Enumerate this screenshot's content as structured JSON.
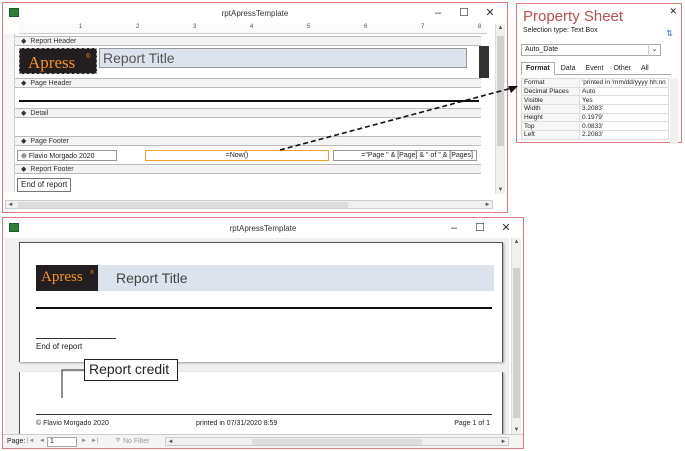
{
  "design_window": {
    "title": "rptApressTemplate",
    "ruler_marks": [
      "1",
      "2",
      "3",
      "4",
      "5",
      "6",
      "7",
      "8"
    ],
    "sections": {
      "report_header": "Report Header",
      "page_header": "Page Header",
      "detail": "Detail",
      "page_footer": "Page Footer",
      "report_footer": "Report Footer"
    },
    "logo_text": "Apress",
    "logo_mark": "®",
    "report_title": "Report Title",
    "footer_author": "Flavio Morgado 2020",
    "footer_date_expr": "=Now()",
    "footer_page_expr": "=\"Page \" & [Page] & \" of \" & [Pages]",
    "end_of_report": "End of report"
  },
  "property_sheet": {
    "title": "Property Sheet",
    "selection_type_label": "Selection type:",
    "selection_type_value": "Text Box",
    "selected_control": "Auto_Date",
    "tabs": [
      "Format",
      "Data",
      "Event",
      "Other",
      "All"
    ],
    "active_tab": "Format",
    "rows": [
      {
        "key": "Format",
        "value": "'printed in  'mm/dd/yyyy hh:nn"
      },
      {
        "key": "Decimal Places",
        "value": "Auto"
      },
      {
        "key": "Visible",
        "value": "Yes"
      },
      {
        "key": "Width",
        "value": "3.2083'"
      },
      {
        "key": "Height",
        "value": "0.1979'"
      },
      {
        "key": "Top",
        "value": "0.0833'"
      },
      {
        "key": "Left",
        "value": "2.2083'"
      }
    ]
  },
  "preview_window": {
    "title": "rptApressTemplate",
    "logo_text": "Apress",
    "logo_mark": "®",
    "report_title": "Report Title",
    "end_of_report": "End of report",
    "callout": "Report credit",
    "footer_author": "© Flavio Morgado 2020",
    "footer_date": "printed in  07/31/2020 8:59",
    "footer_page": "Page 1 of 1",
    "nav": {
      "page_label": "Page:",
      "page_value": "1",
      "filter_label": "No Filter"
    }
  },
  "colors": {
    "accent_red": "#c0504d",
    "window_border": "#e07b7b",
    "logo_bg": "#231f20",
    "logo_text": "#f7941d",
    "header_band": "#dde3ec",
    "selected_ctrl": "#f0a030"
  }
}
